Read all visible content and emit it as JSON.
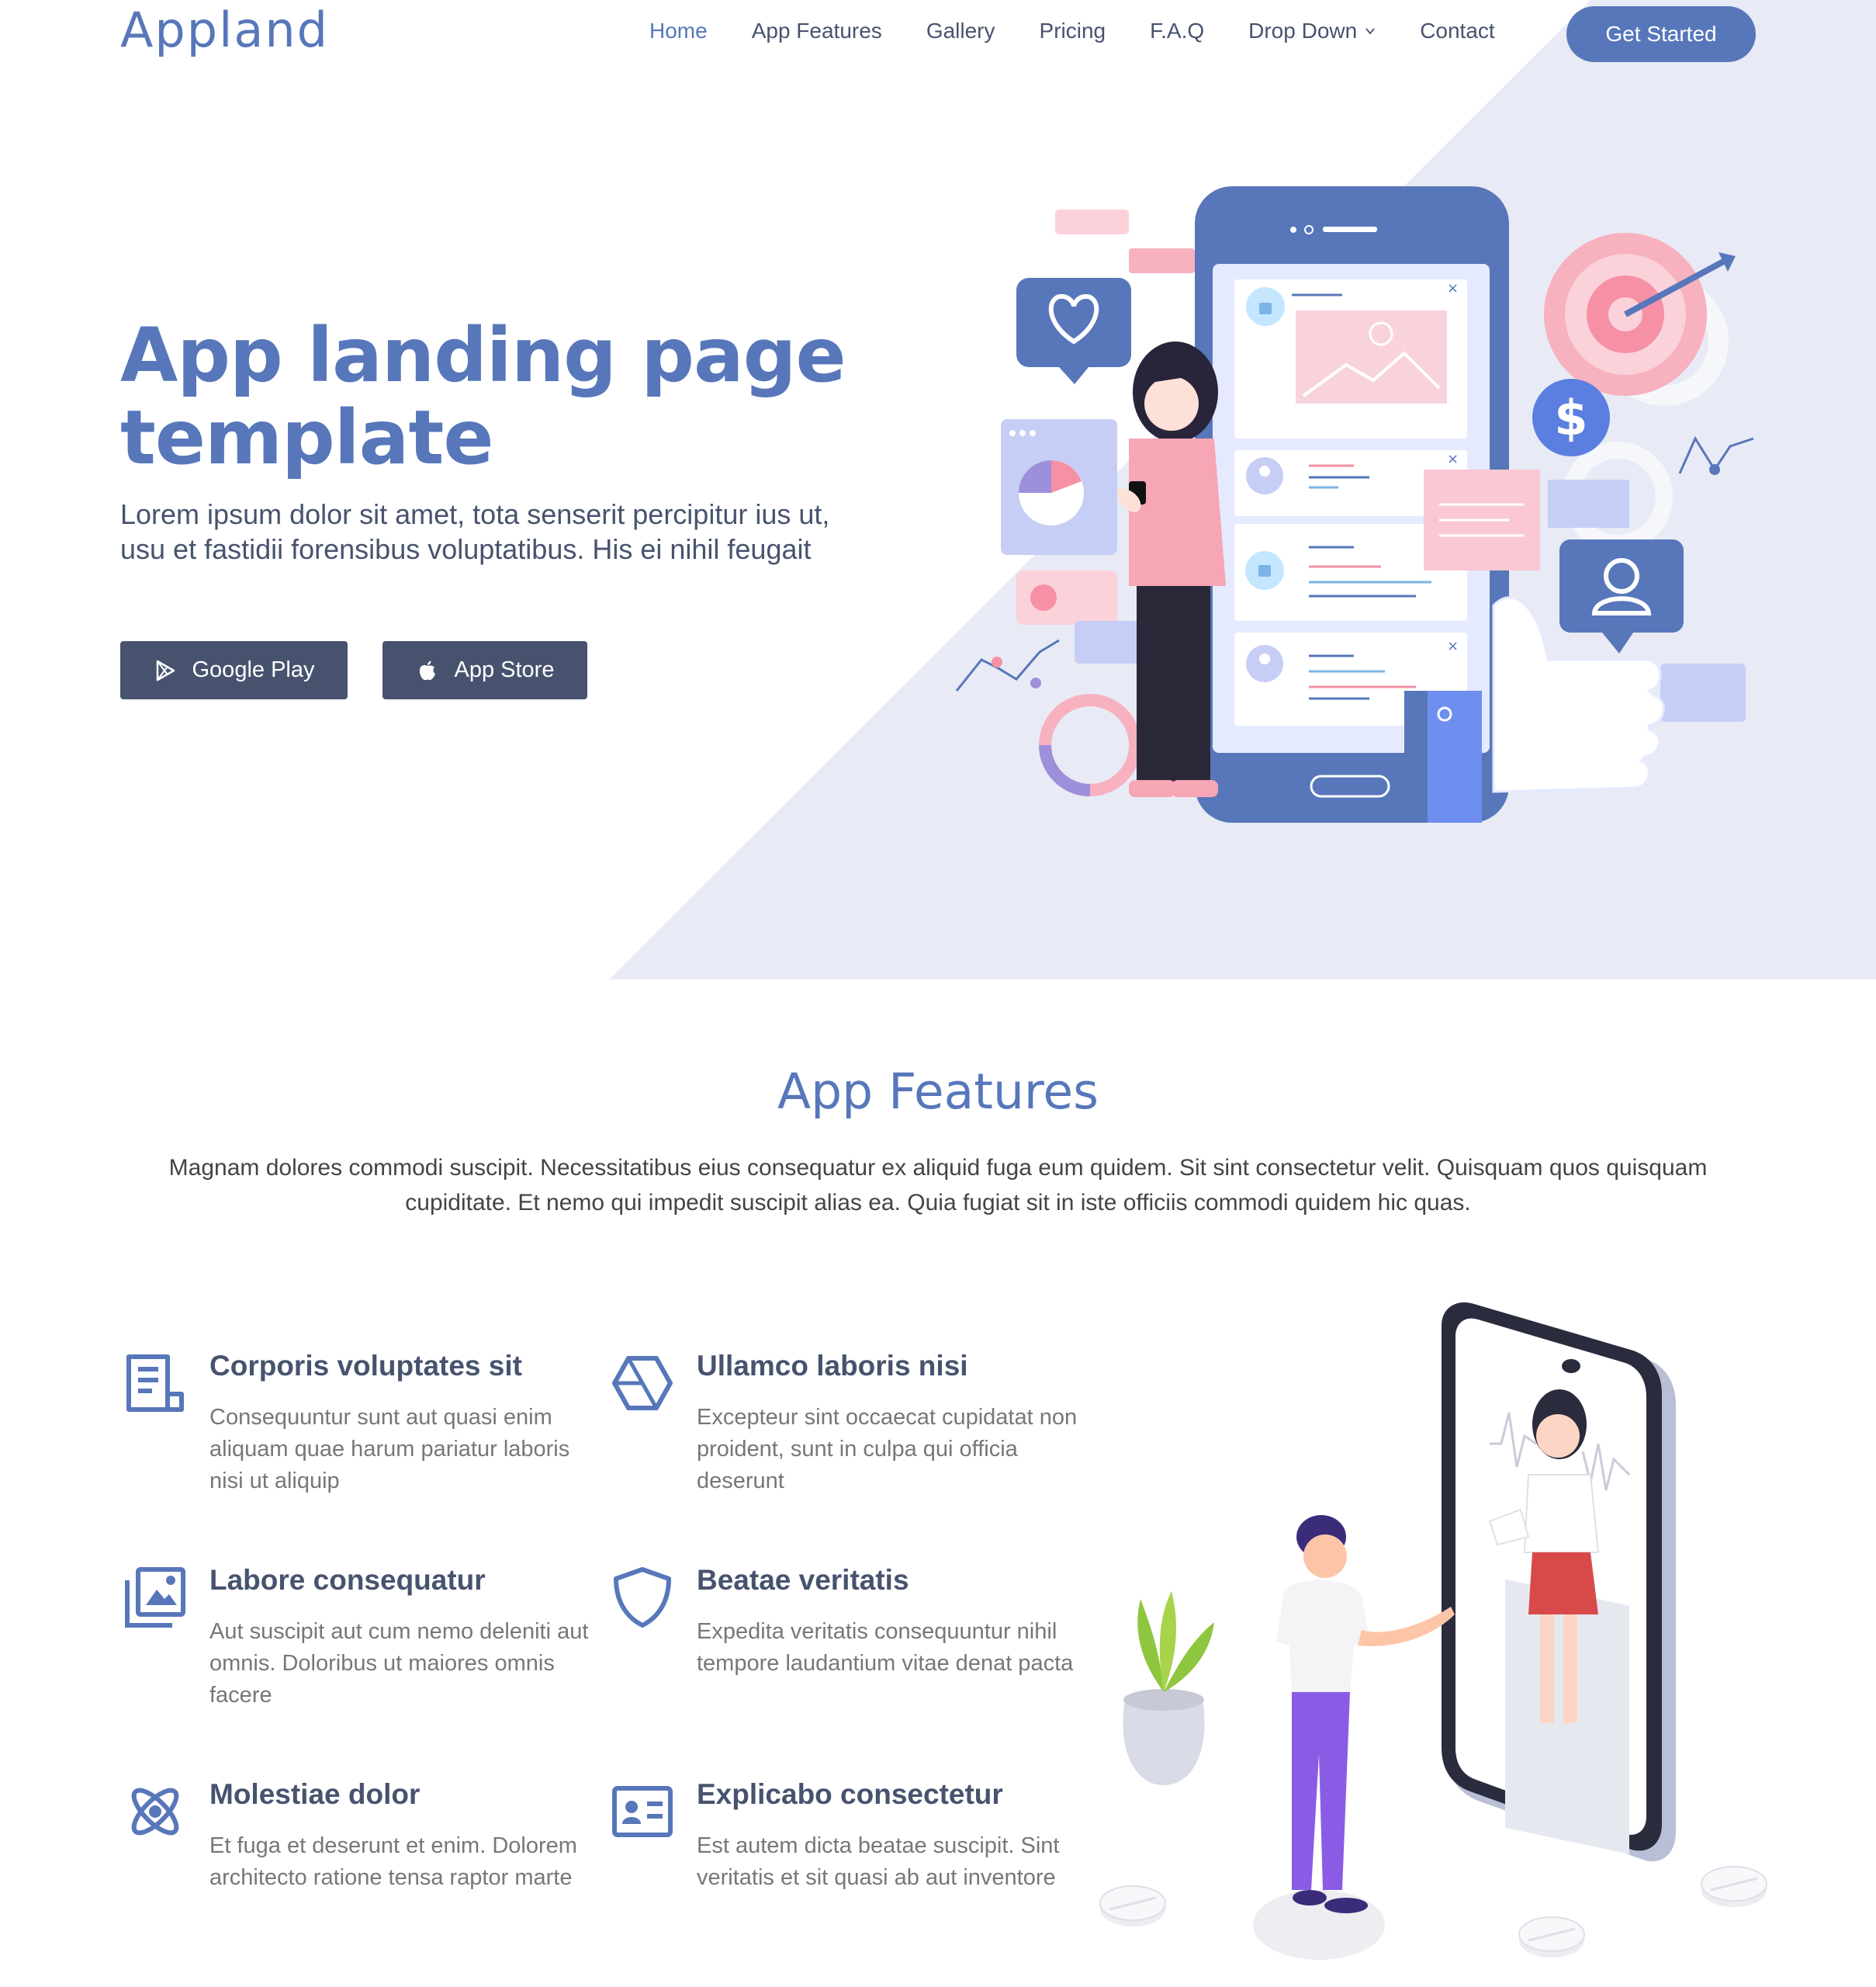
{
  "header": {
    "logo": "Appland",
    "nav": [
      {
        "label": "Home",
        "active": true
      },
      {
        "label": "App Features"
      },
      {
        "label": "Gallery"
      },
      {
        "label": "Pricing"
      },
      {
        "label": "F.A.Q"
      },
      {
        "label": "Drop Down",
        "has_dropdown": true
      },
      {
        "label": "Contact"
      }
    ],
    "cta": "Get Started"
  },
  "hero": {
    "title_line1": "App landing page",
    "title_line2": "template",
    "subtitle_line1": "Lorem ipsum dolor sit amet, tota senserit percipitur ius ut,",
    "subtitle_line2": "usu et fastidii forensibus voluptatibus. His ei nihil feugait",
    "google_play": "Google Play",
    "app_store": "App Store"
  },
  "features": {
    "title": "App Features",
    "description_line1": "Magnam dolores commodi suscipit. Necessitatibus eius consequatur ex aliquid fuga eum quidem. Sit sint consectetur velit. Quisquam quos quisquam",
    "description_line2": "cupiditate. Et nemo qui impedit suscipit alias ea. Quia fugiat sit in iste officiis commodi quidem hic quas.",
    "items": [
      {
        "icon": "receipt-icon",
        "title": "Corporis voluptates sit",
        "text": "Consequuntur sunt aut quasi enim aliquam quae harum pariatur laboris nisi ut aliquip"
      },
      {
        "icon": "cube-icon",
        "title": "Ullamco laboris nisi",
        "text": "Excepteur sint occaecat cupidatat non proident, sunt in culpa qui officia deserunt"
      },
      {
        "icon": "images-icon",
        "title": "Labore consequatur",
        "text": "Aut suscipit aut cum nemo deleniti aut omnis. Doloribus ut maiores omnis facere"
      },
      {
        "icon": "shield-icon",
        "title": "Beatae veritatis",
        "text": "Expedita veritatis consequuntur nihil tempore laudantium vitae denat pacta"
      },
      {
        "icon": "atom-icon",
        "title": "Molestiae dolor",
        "text": "Et fuga et deserunt et enim. Dolorem architecto ratione tensa raptor marte"
      },
      {
        "icon": "id-card-icon",
        "title": "Explicabo consectetur",
        "text": "Est autem dicta beatae suscipit. Sint veritatis et sit quasi ab aut inventore"
      }
    ]
  },
  "colors": {
    "primary": "#5777ba",
    "dark": "#47536e",
    "hero_bg": "#e8ebf5",
    "pink": "#f5a9b8"
  }
}
